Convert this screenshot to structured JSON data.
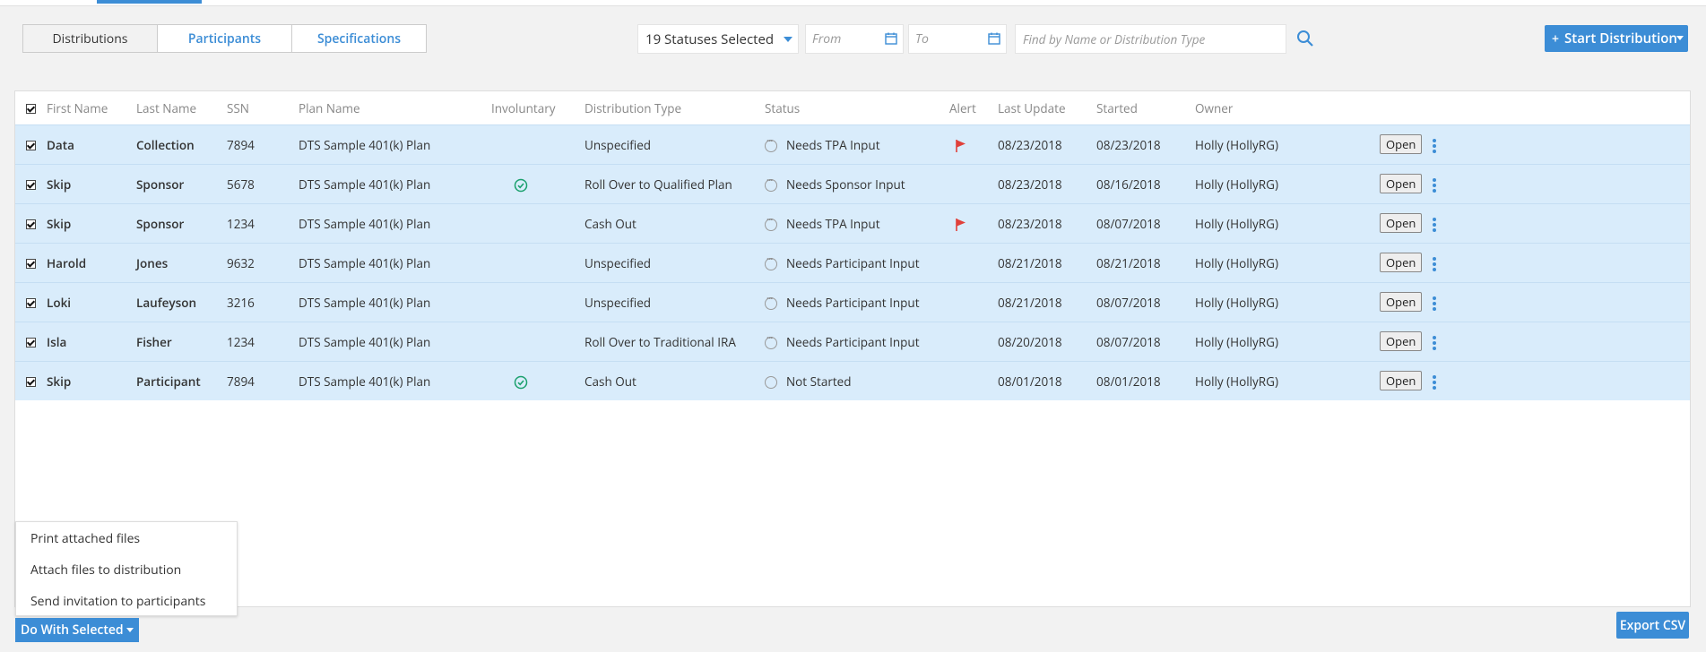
{
  "tabs": [
    {
      "label": "Distributions"
    },
    {
      "label": "Participants"
    },
    {
      "label": "Specifications"
    }
  ],
  "filters": {
    "status_selected": "19 Statuses Selected",
    "from_placeholder": "From",
    "to_placeholder": "To",
    "search_placeholder": "Find by Name or Distribution Type"
  },
  "start_button": "Start Distribution",
  "columns": {
    "first_name": "First Name",
    "last_name": "Last Name",
    "ssn": "SSN",
    "plan_name": "Plan Name",
    "involuntary": "Involuntary",
    "distribution_type": "Distribution Type",
    "status": "Status",
    "alert": "Alert",
    "last_update": "Last Update",
    "started": "Started",
    "owner": "Owner"
  },
  "rows": [
    {
      "first": "Data",
      "last": "Collection",
      "ssn": "7894",
      "plan": "DTS Sample 401(k) Plan",
      "involuntary": false,
      "type": "Unspecified",
      "status": "Needs TPA Input",
      "status_icon": "dots",
      "alert": true,
      "last_update": "08/23/2018",
      "started": "08/23/2018",
      "owner": "Holly (HollyRG)",
      "action": "Open"
    },
    {
      "first": "Skip",
      "last": "Sponsor",
      "ssn": "5678",
      "plan": "DTS Sample 401(k) Plan",
      "involuntary": true,
      "type": "Roll Over to Qualified Plan",
      "status": "Needs Sponsor Input",
      "status_icon": "dots",
      "alert": false,
      "last_update": "08/23/2018",
      "started": "08/16/2018",
      "owner": "Holly (HollyRG)",
      "action": "Open"
    },
    {
      "first": "Skip",
      "last": "Sponsor",
      "ssn": "1234",
      "plan": "DTS Sample 401(k) Plan",
      "involuntary": false,
      "type": "Cash Out",
      "status": "Needs TPA Input",
      "status_icon": "dots",
      "alert": true,
      "last_update": "08/23/2018",
      "started": "08/07/2018",
      "owner": "Holly (HollyRG)",
      "action": "Open"
    },
    {
      "first": "Harold",
      "last": "Jones",
      "ssn": "9632",
      "plan": "DTS Sample 401(k) Plan",
      "involuntary": false,
      "type": "Unspecified",
      "status": "Needs Participant Input",
      "status_icon": "dots",
      "alert": false,
      "last_update": "08/21/2018",
      "started": "08/21/2018",
      "owner": "Holly (HollyRG)",
      "action": "Open"
    },
    {
      "first": "Loki",
      "last": "Laufeyson",
      "ssn": "3216",
      "plan": "DTS Sample 401(k) Plan",
      "involuntary": false,
      "type": "Unspecified",
      "status": "Needs Participant Input",
      "status_icon": "dots",
      "alert": false,
      "last_update": "08/21/2018",
      "started": "08/07/2018",
      "owner": "Holly (HollyRG)",
      "action": "Open"
    },
    {
      "first": "Isla",
      "last": "Fisher",
      "ssn": "1234",
      "plan": "DTS Sample 401(k) Plan",
      "involuntary": false,
      "type": "Roll Over to Traditional IRA",
      "status": "Needs Participant Input",
      "status_icon": "dots",
      "alert": false,
      "last_update": "08/20/2018",
      "started": "08/07/2018",
      "owner": "Holly (HollyRG)",
      "action": "Open"
    },
    {
      "first": "Skip",
      "last": "Participant",
      "ssn": "7894",
      "plan": "DTS Sample 401(k) Plan",
      "involuntary": true,
      "type": "Cash Out",
      "status": "Not Started",
      "status_icon": "empty",
      "alert": false,
      "last_update": "08/01/2018",
      "started": "08/01/2018",
      "owner": "Holly (HollyRG)",
      "action": "Open"
    }
  ],
  "menu_items": [
    {
      "label": "Print attached files"
    },
    {
      "label": "Attach files to distribution"
    },
    {
      "label": "Send invitation to participants"
    }
  ],
  "do_with_selected": "Do With Selected",
  "export_csv": "Export CSV",
  "colors": {
    "accent": "#3c8dd6",
    "row_selected": "#d9ecfb",
    "alert_flag": "#e0403a",
    "check_green": "#1aa06d"
  }
}
